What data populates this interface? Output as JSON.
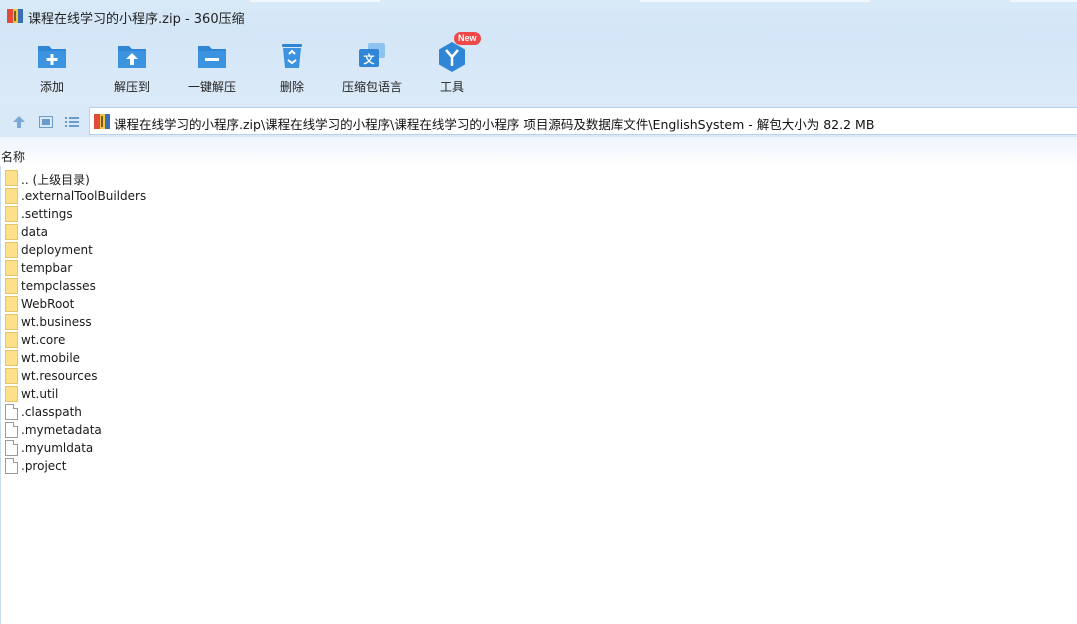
{
  "window": {
    "title": "课程在线学习的小程序.zip - 360压缩"
  },
  "toolbar": {
    "items": [
      {
        "label": "添加",
        "icon": "add-folder-icon"
      },
      {
        "label": "解压到",
        "icon": "extract-to-icon"
      },
      {
        "label": "一键解压",
        "icon": "one-click-extract-icon"
      },
      {
        "label": "删除",
        "icon": "recycle-bin-icon"
      },
      {
        "label": "压缩包语言",
        "icon": "archive-language-icon"
      },
      {
        "label": "工具",
        "icon": "tools-icon",
        "badge": "New"
      }
    ]
  },
  "addressbar": {
    "path": "课程在线学习的小程序.zip\\课程在线学习的小程序\\课程在线学习的小程序 项目源码及数据库文件\\EnglishSystem - 解包大小为 82.2 MB"
  },
  "filelist": {
    "column_header": "名称",
    "items": [
      {
        "name": ".. (上级目录)",
        "type": "folder"
      },
      {
        "name": ".externalToolBuilders",
        "type": "folder"
      },
      {
        "name": ".settings",
        "type": "folder"
      },
      {
        "name": "data",
        "type": "folder"
      },
      {
        "name": "deployment",
        "type": "folder"
      },
      {
        "name": "tempbar",
        "type": "folder"
      },
      {
        "name": "tempclasses",
        "type": "folder"
      },
      {
        "name": "WebRoot",
        "type": "folder"
      },
      {
        "name": "wt.business",
        "type": "folder"
      },
      {
        "name": "wt.core",
        "type": "folder"
      },
      {
        "name": "wt.mobile",
        "type": "folder"
      },
      {
        "name": "wt.resources",
        "type": "folder"
      },
      {
        "name": "wt.util",
        "type": "folder"
      },
      {
        "name": ".classpath",
        "type": "file"
      },
      {
        "name": ".mymetadata",
        "type": "file"
      },
      {
        "name": ".myumldata",
        "type": "file"
      },
      {
        "name": ".project",
        "type": "file"
      }
    ]
  },
  "colors": {
    "toolbar_bg": "#d4e6f7",
    "icon_blue": "#2f86d6",
    "badge_red": "#f04848",
    "folder_yellow": "#fde08a"
  }
}
